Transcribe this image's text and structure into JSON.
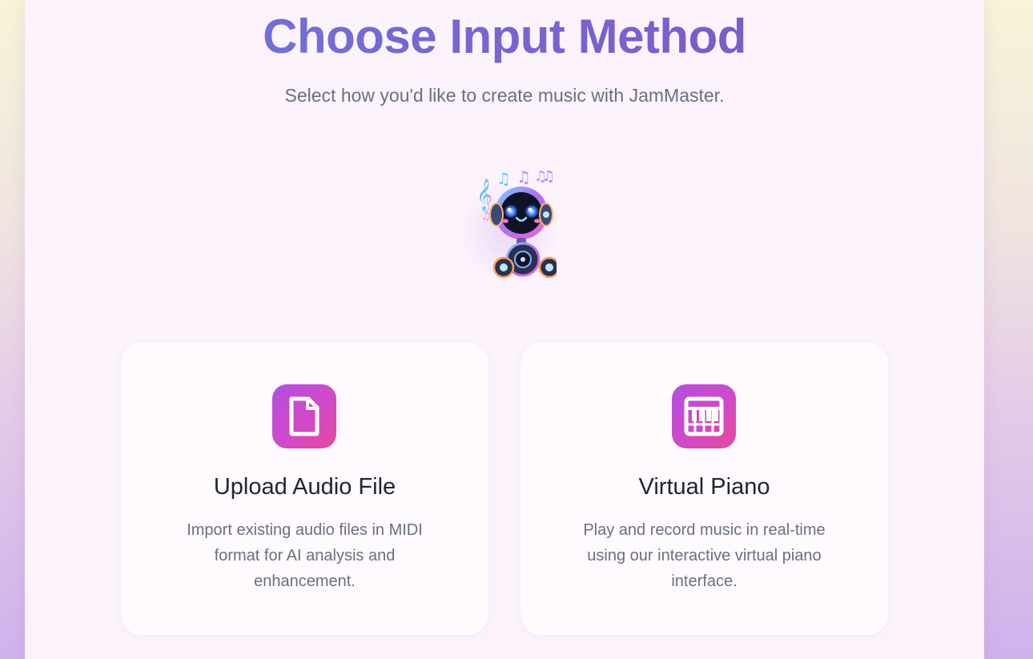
{
  "header": {
    "title": "Choose Input Method",
    "subtitle": "Select how you'd like to create music with JamMaster."
  },
  "mascot": {
    "icon": "robot-dj-mascot-icon"
  },
  "options": [
    {
      "icon": "file-icon",
      "title": "Upload Audio File",
      "description": "Import existing audio files in MIDI format for AI analysis and enhancement."
    },
    {
      "icon": "piano-icon",
      "title": "Virtual Piano",
      "description": "Play and record music in real-time using our interactive virtual piano interface."
    }
  ],
  "colors": {
    "accent_gradient_start": "#b24fe0",
    "accent_gradient_end": "#e9479e",
    "title_gradient_start": "#6a79d9",
    "title_gradient_end": "#7a55b8"
  }
}
